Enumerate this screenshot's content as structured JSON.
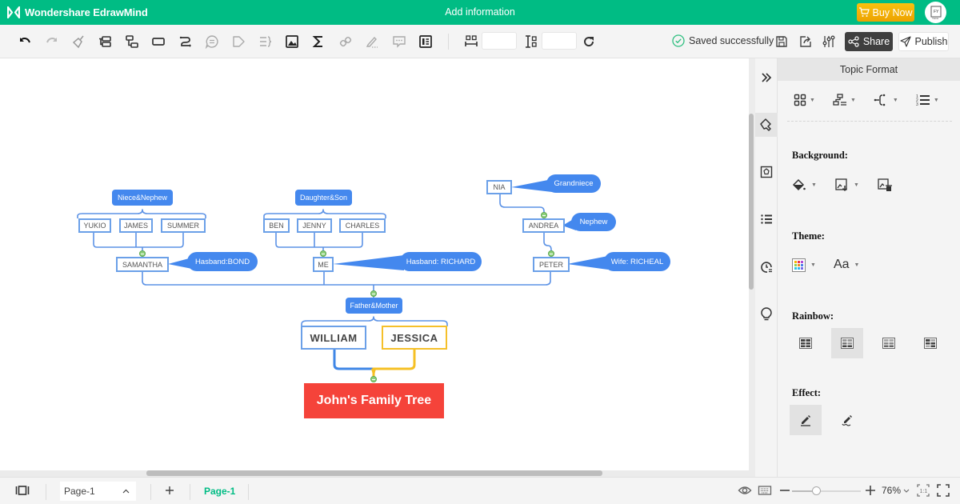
{
  "titlebar": {
    "app_name": "Wondershare EdrawMind",
    "doc_title": "Add information",
    "buy_label": "Buy Now",
    "avatar_text": "FY"
  },
  "toolbar": {
    "icons": [
      "undo-icon",
      "redo-icon",
      "format-painter-icon",
      "add-topic-icon",
      "add-subtopic-icon",
      "floating-topic-icon",
      "relationship-icon",
      "callout-icon",
      "boundary-icon",
      "summary-icon",
      "image-icon",
      "formula-icon",
      "hyperlink-icon",
      "note-icon",
      "comment-icon",
      "outline-icon"
    ],
    "width_value": "",
    "height_value": "",
    "saved_label": "Saved successfully",
    "share_label": "Share",
    "publish_label": "Publish"
  },
  "canvas": {
    "root": "John's Family Tree",
    "parents_label": "Father&Mother",
    "parents": [
      "WILLIAM",
      "JESSICA"
    ],
    "children": [
      {
        "name": "SAMANTHA",
        "callout": "Hasband:BOND",
        "group_label": "Niece&Nephew",
        "kids": [
          "YUKIO",
          "JAMES",
          "SUMMER"
        ]
      },
      {
        "name": "ME",
        "callout": "Hasband: RICHARD",
        "group_label": "Daughter&Son",
        "kids": [
          "BEN",
          "JENNY",
          "CHARLES"
        ]
      },
      {
        "name": "PETER",
        "callout": "Wife: RICHEAL",
        "child": {
          "name": "ANDREA",
          "callout": "Nephew",
          "child": {
            "name": "NIA",
            "callout": "Grandniece"
          }
        }
      }
    ],
    "colors": {
      "root": "#f5433a",
      "label": "#4488ee",
      "line": "#5d93e6",
      "mother_border": "#f5c02a"
    }
  },
  "panel": {
    "title": "Topic Format",
    "background_label": "Background:",
    "theme_label": "Theme:",
    "theme_font_label": "Aa",
    "rainbow_label": "Rainbow:",
    "rainbow_selected": 1,
    "effect_label": "Effect:",
    "effect_selected": 0
  },
  "statusbar": {
    "page_select": "Page-1",
    "page_tab": "Page-1",
    "zoom_percent": 76,
    "zoom_label": "76%",
    "zoom_fraction": 0.35
  }
}
